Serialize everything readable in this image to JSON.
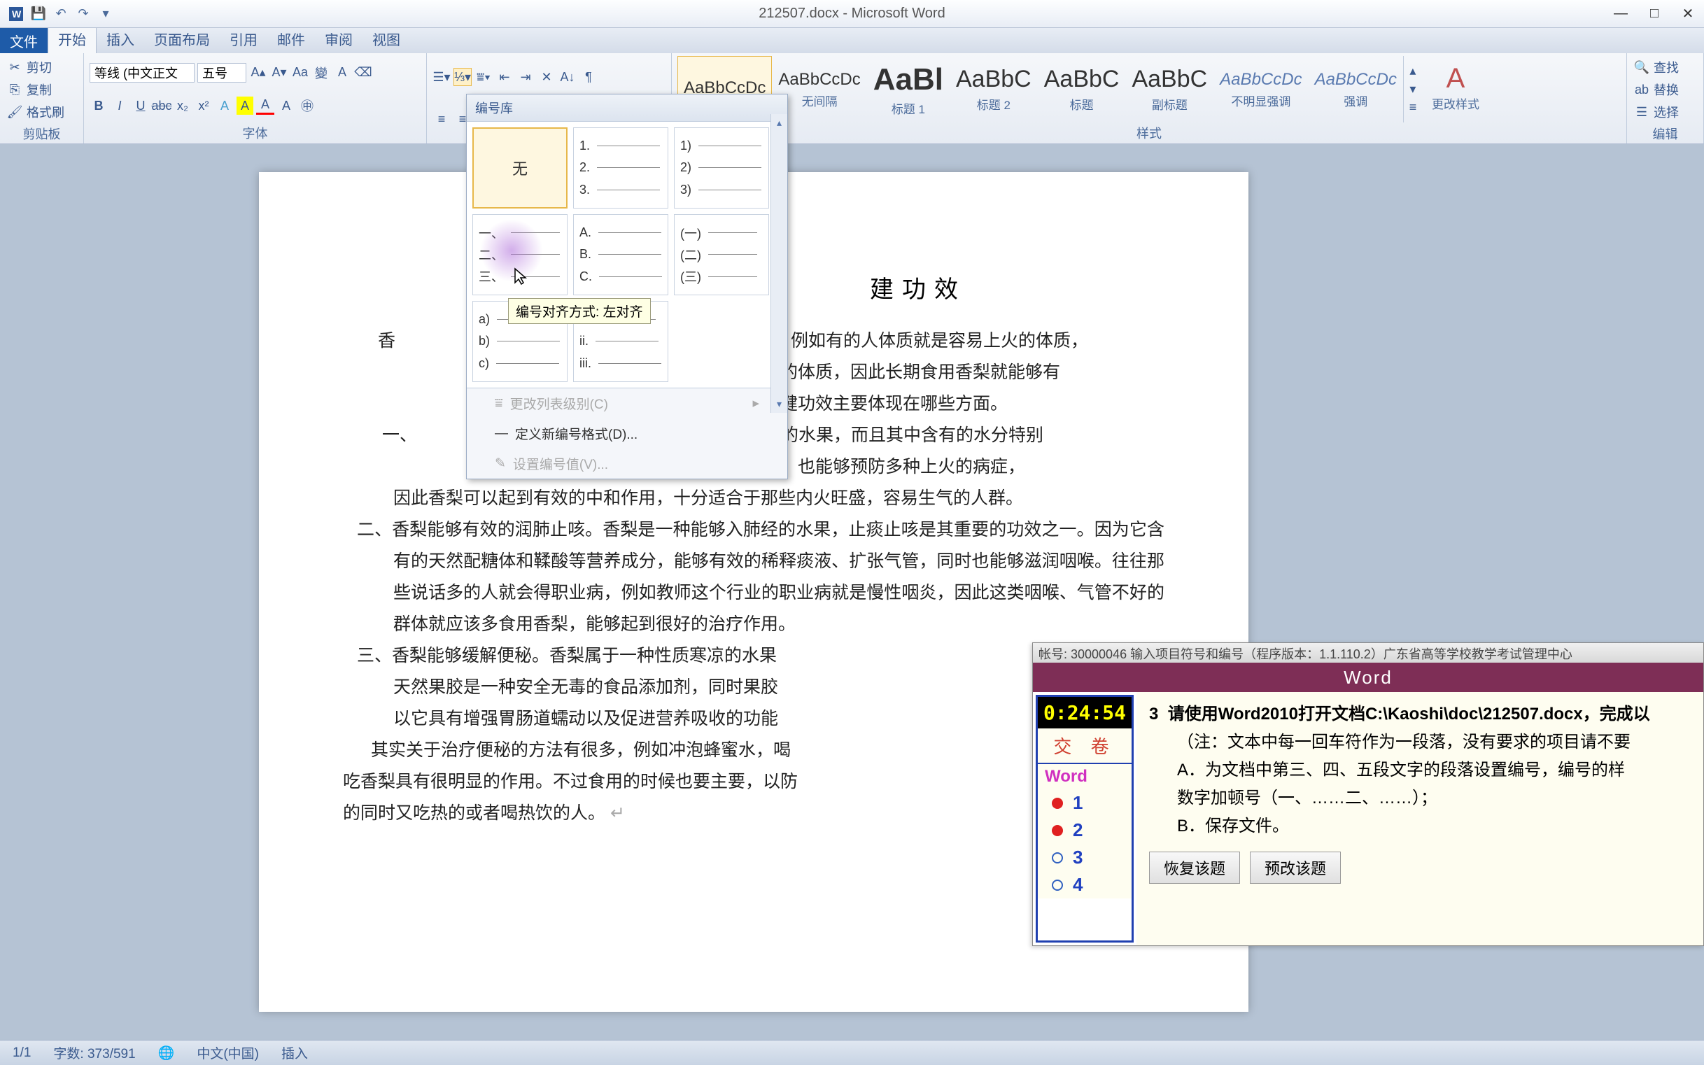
{
  "title": "212507.docx - Microsoft Word",
  "tabs": {
    "file": "文件",
    "home": "开始",
    "insert": "插入",
    "layout": "页面布局",
    "ref": "引用",
    "mail": "邮件",
    "review": "审阅",
    "view": "视图"
  },
  "clipboard": {
    "cut": "剪切",
    "copy": "复制",
    "painter": "格式刷",
    "label": "剪贴板"
  },
  "font": {
    "name": "等线 (中文正文",
    "size": "五号",
    "label": "字体"
  },
  "styles": {
    "label": "样式",
    "items": [
      {
        "preview": "AaBbCcDc",
        "name": "",
        "cls": ""
      },
      {
        "preview": "AaBbCcDc",
        "name": "无间隔",
        "cls": ""
      },
      {
        "preview": "AaBl",
        "name": "标题 1",
        "cls": "big"
      },
      {
        "preview": "AaBbC",
        "name": "标题 2",
        "cls": ""
      },
      {
        "preview": "AaBbC",
        "name": "标题",
        "cls": ""
      },
      {
        "preview": "AaBbC",
        "name": "副标题",
        "cls": ""
      },
      {
        "preview": "AaBbCcDc",
        "name": "不明显强调",
        "cls": "italic"
      },
      {
        "preview": "AaBbCcDc",
        "name": "强调",
        "cls": "italic"
      }
    ],
    "change": "更改样式"
  },
  "editing": {
    "find": "查找",
    "replace": "替换",
    "select": "选择",
    "label": "编辑"
  },
  "numbering": {
    "header": "编号库",
    "none": "无",
    "tooltip": "编号对齐方式: 左对齐",
    "menu1": "更改列表级别(C)",
    "menu2": "定义新编号格式(D)...",
    "menu3": "设置编号值(V)...",
    "formats": {
      "r1c2": [
        "1.",
        "2.",
        "3."
      ],
      "r1c3": [
        "1)",
        "2)",
        "3)"
      ],
      "r2c1": [
        "一、",
        "二、",
        "三、"
      ],
      "r2c2": [
        "A.",
        "B.",
        "C."
      ],
      "r2c3": [
        "(一)",
        "(二)",
        "(三)"
      ],
      "r3c1": [
        "a)",
        "b)",
        "c)"
      ],
      "r3c2": [
        "i.",
        "ii.",
        "iii."
      ]
    }
  },
  "doc": {
    "title_fragment": "建功效",
    "p1_a": "香",
    "p1_b": "的治疗上，例如有的人体质就是容易上火的体质，",
    "p1_c": "够改变这样的体质，因此长期食用香梨就能够有",
    "p1_d": "下香梨的保健功效主要体现在哪些方面。",
    "p2_a": "一、",
    "p2_b": "性质寒凉的水果，而且其中含有的水分特别",
    "p2_c": "够清除内火，也能够预防多种上火的病症，",
    "p2_d": "因此香梨可以起到有效的中和作用，十分适合于那些内火旺盛，容易生气的人群。",
    "p3": "二、香梨能够有效的润肺止咳。香梨是一种能够入肺经的水果，止痰止咳是其重要的功效之一。因为它含有的天然配糖体和鞣酸等营养成分，能够有效的稀释痰液、扩张气管，同时也能够滋润咽喉。往往那些说话多的人就会得职业病，例如教师这个行业的职业病就是慢性咽炎，因此这类咽喉、气管不好的群体就应该多食用香梨，能够起到很好的治疗作用。",
    "p4": "三、香梨能够缓解便秘。香梨属于一种性质寒凉的水果",
    "p4b": "天然果胶是一种安全无毒的食品添加剂，同时果胶",
    "p4c": "以它具有增强胃肠道蠕动以及促进营养吸收的功能",
    "p5": "其实关于治疗便秘的方法有很多，例如冲泡蜂蜜水，喝",
    "p5b": "吃香梨具有很明显的作用。不过食用的时候也要主要，以防",
    "p5c": "的同时又吃热的或者喝热饮的人。"
  },
  "exam": {
    "titlebar": "帐号: 30000046   输入项目符号和编号（程序版本：1.1.110.2）广东省高等学校教学考试管理中心",
    "header": "Word",
    "timer": "0:24:54",
    "submit": "交 卷",
    "section": "Word",
    "nav": [
      "1",
      "2",
      "3",
      "4"
    ],
    "q_num": "3",
    "q_text": "请使用Word2010打开文档C:\\Kaoshi\\doc\\212507.docx，完成以",
    "q_note": "（注：文本中每一回车符作为一段落，没有要求的项目请不要",
    "q_a": "A．为文档中第三、四、五段文字的段落设置编号，编号的样",
    "q_a2": "数字加顿号（一、……二、……）；",
    "q_b": "B．保存文件。",
    "btn1": "恢复该题",
    "btn2": "预改该题"
  },
  "status": {
    "page": "1/1",
    "words": "字数: 373/591",
    "lang": "中文(中国)",
    "mode": "插入"
  }
}
